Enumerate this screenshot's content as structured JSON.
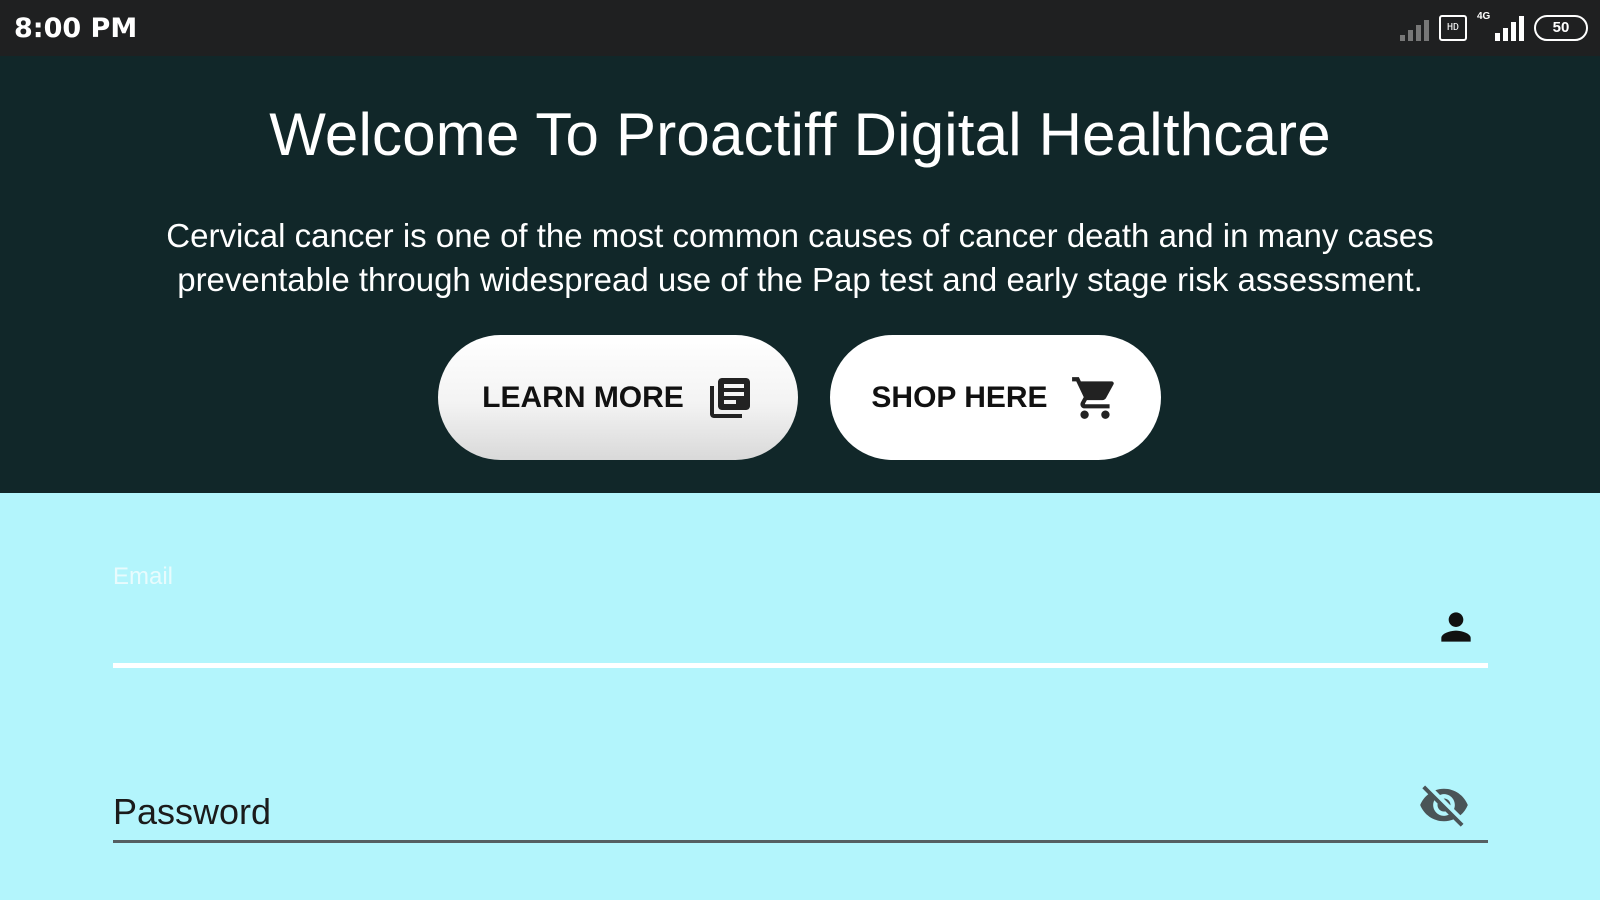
{
  "status_bar": {
    "time": "8:00 PM",
    "icons": [
      "signal-weak-icon",
      "sim-card-icon",
      "signal-4g-icon",
      "battery-icon"
    ],
    "network_label": "4G",
    "battery_level": "50",
    "sim_label": "HD"
  },
  "hero": {
    "title": "Welcome To Proactiff Digital Healthcare",
    "description_line1": "Cervical cancer is one of the most common causes of cancer death and in many cases",
    "description_line2": "preventable through widespread use of the Pap test and early stage risk assessment.",
    "background_color": "#112729",
    "buttons": {
      "learn_more": {
        "label": "LEARN MORE",
        "icon": "newspaper-icon"
      },
      "shop_here": {
        "label": "SHOP HERE",
        "icon": "shopping-cart-icon"
      }
    }
  },
  "form": {
    "background_color": "#b3f5fc",
    "email": {
      "label": "Email",
      "value": "",
      "icon": "person-icon"
    },
    "password": {
      "placeholder": "Password",
      "value": "",
      "icon": "visibility-off-icon"
    }
  }
}
